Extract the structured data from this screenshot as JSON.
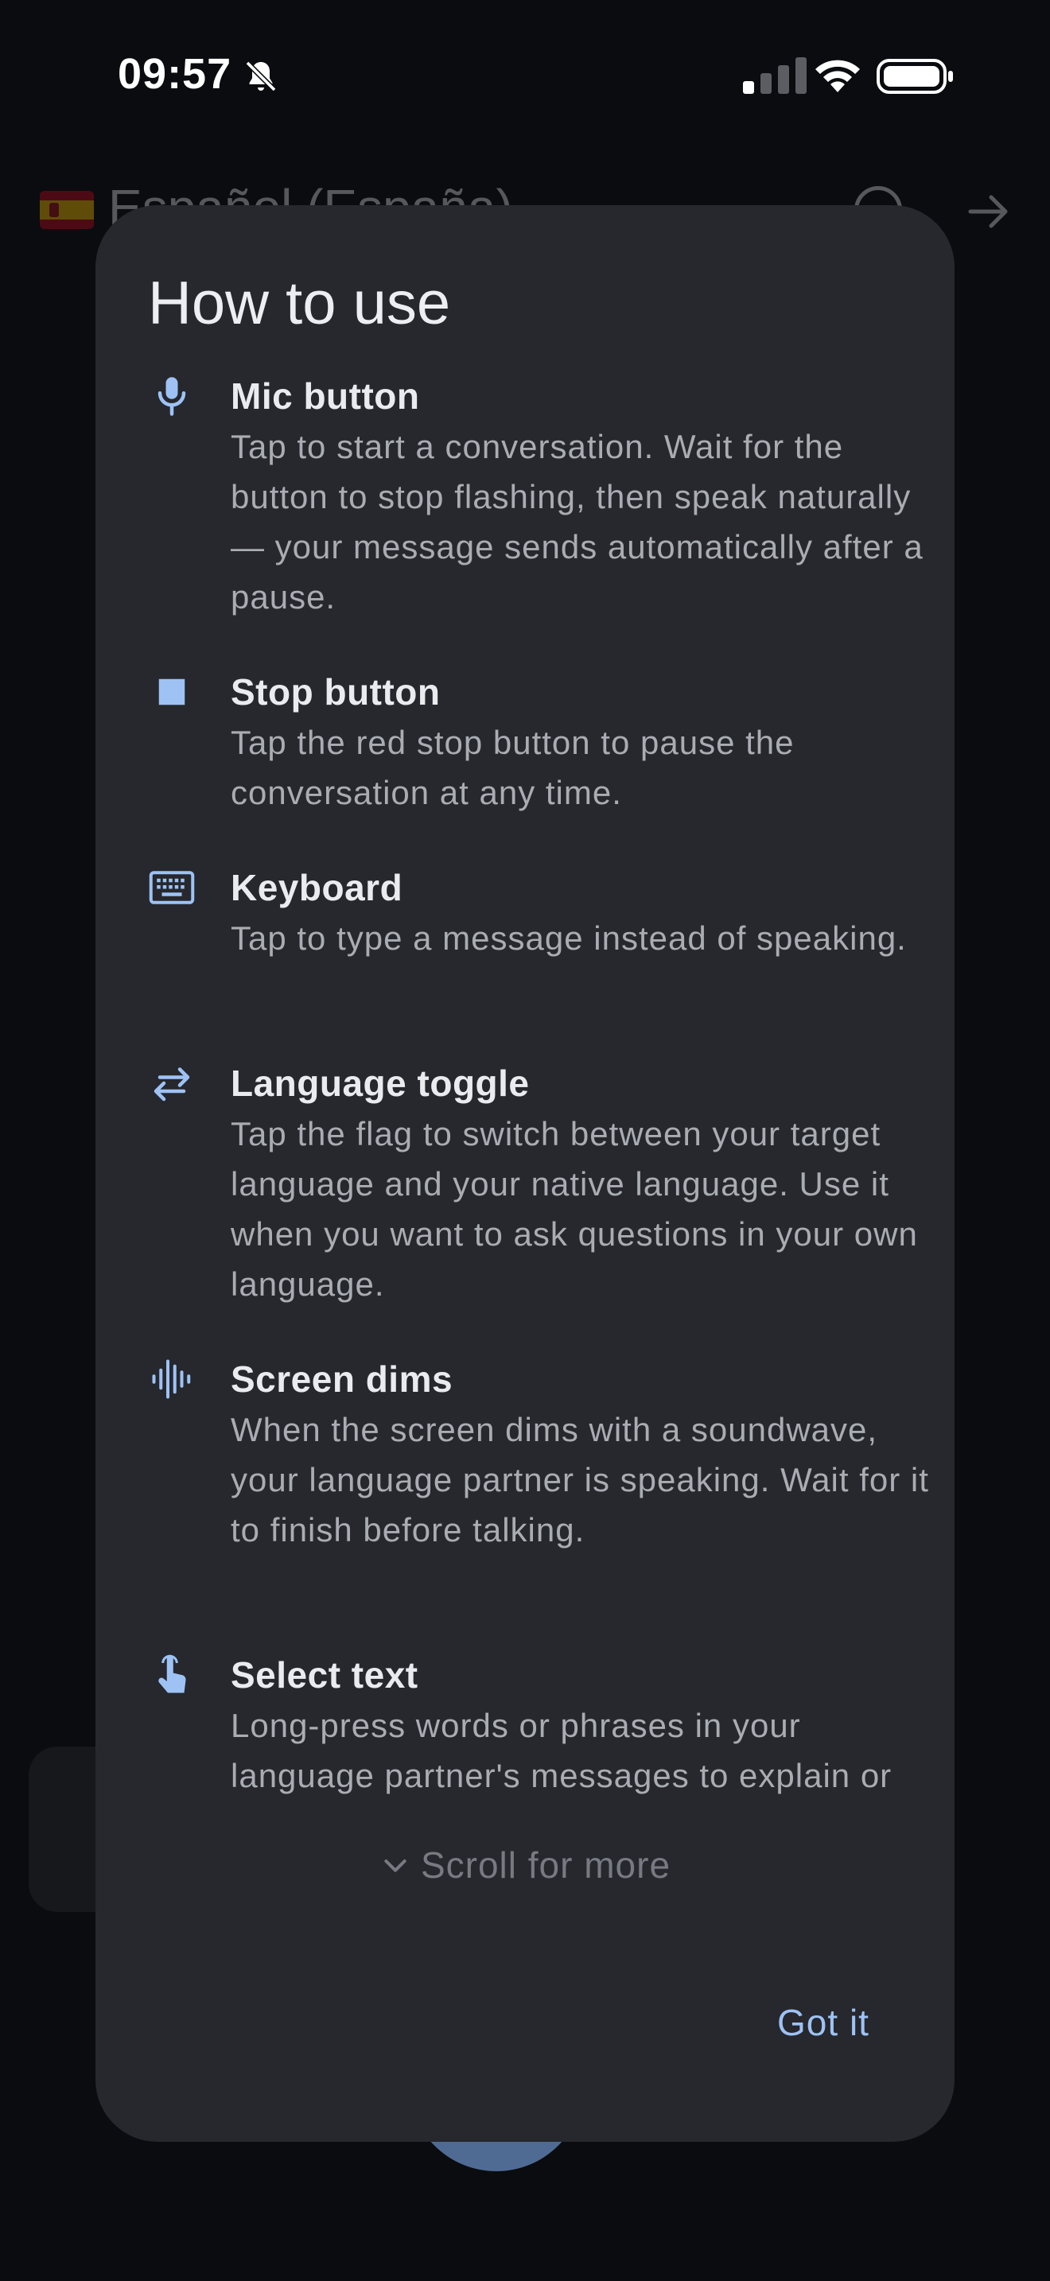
{
  "status_bar": {
    "time": "09:57"
  },
  "background": {
    "language_label": "Español (España)"
  },
  "dialog": {
    "title": "How to use",
    "items": [
      {
        "icon": "mic-icon",
        "title": "Mic button",
        "body": "Tap to start a conversation. Wait for the button to stop flashing, then speak naturally — your message sends automatically after a pause."
      },
      {
        "icon": "stop-icon",
        "title": "Stop button",
        "body": "Tap the red stop button to pause the conversation at any time."
      },
      {
        "icon": "keyboard-icon",
        "title": "Keyboard",
        "body": "Tap to type a message instead of speaking."
      },
      {
        "icon": "swap-arrows-icon",
        "title": "Language toggle",
        "body": "Tap the flag to switch between your target language and your native language. Use it when you want to ask questions in your own language."
      },
      {
        "icon": "soundwave-icon",
        "title": "Screen dims",
        "body": "When the screen dims with a soundwave, your language partner is speaking. Wait for it to finish before talking."
      },
      {
        "icon": "touch-icon",
        "title": "Select text",
        "body": "Long-press words or phrases in your language partner's messages to explain or translate them."
      }
    ],
    "scroll_hint": "Scroll for more",
    "confirm_label": "Got it"
  },
  "colors": {
    "accent": "#9ec2f4",
    "dialog_bg": "#26282d",
    "screen_bg": "#0b0c0f"
  }
}
